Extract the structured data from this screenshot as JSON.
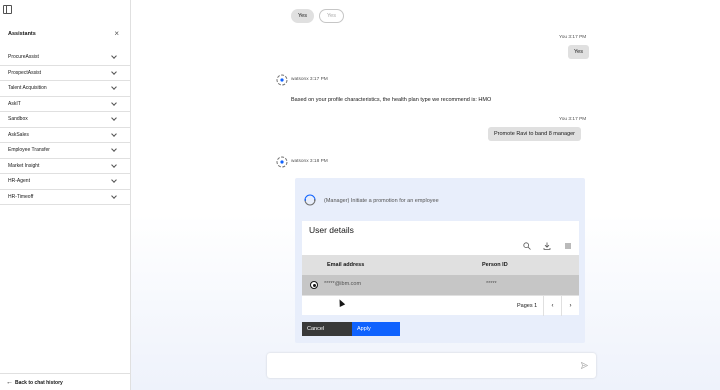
{
  "sidebar": {
    "title": "Assistants",
    "close_glyph": "×",
    "items": [
      {
        "label": "ProcureAssist"
      },
      {
        "label": "ProspectAssist"
      },
      {
        "label": "Talent Acquisition"
      },
      {
        "label": "AskIT"
      },
      {
        "label": "Sandbox"
      },
      {
        "label": "AskSales"
      },
      {
        "label": "Employee Transfer"
      },
      {
        "label": "Market Insight"
      },
      {
        "label": "HR-Agent"
      },
      {
        "label": "HR-Timeoff"
      }
    ],
    "back_arrow": "←",
    "back_label": "Back to chat history"
  },
  "chat": {
    "quick_replies": [
      "Yes",
      "Yes"
    ],
    "messages": [
      {
        "who": "user",
        "meta": "You 3:17 PM",
        "text": "Yes"
      },
      {
        "who": "bot",
        "meta": "watsonx 3:17 PM",
        "text": "Based on your profile characteristics, the health plan type we recommend is: HMO"
      },
      {
        "who": "user",
        "meta": "You 3:17 PM",
        "text": "Promote Ravi to band 8 manager"
      },
      {
        "who": "bot",
        "meta": "watsonx 3:18 PM"
      }
    ],
    "card": {
      "title": "(Manager) Initiate a promotion for an employee",
      "table_title": "User details",
      "columns": [
        "Email address",
        "Person ID"
      ],
      "rows": [
        {
          "email": "*****@ibm.com",
          "person_id": "*****",
          "selected": true
        }
      ],
      "pager": {
        "label": "Pages 1",
        "prev": "‹",
        "next": "›"
      },
      "cancel_label": "Cancel",
      "apply_label": "Apply"
    },
    "composer": {
      "placeholder": "",
      "value": ""
    }
  },
  "colors": {
    "accent": "#0f62fe",
    "card_bg": "#e8eefb",
    "cancel_bg": "#393939"
  },
  "icons": [
    "panel-toggle-icon",
    "close-icon",
    "chevron-down-icon",
    "back-arrow-icon",
    "watsonx-avatar-icon",
    "flow-icon",
    "search-icon",
    "download-icon",
    "settings-icon",
    "send-icon"
  ]
}
